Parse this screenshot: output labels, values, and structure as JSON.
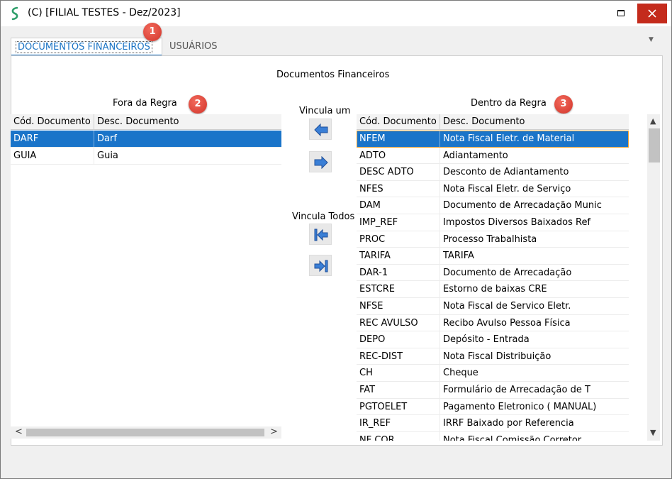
{
  "window": {
    "title": "(C)  [FILIAL TESTES - Dez/2023]",
    "icon": "s-logo-icon",
    "accent": "#1a74c9"
  },
  "tabs": [
    {
      "label": "DOCUMENTOS FINANCEIROS",
      "active": true
    },
    {
      "label": "USUÁRIOS",
      "active": false
    }
  ],
  "badges": [
    "1",
    "2",
    "3"
  ],
  "section_title": "Documentos Financeiros",
  "left_grid": {
    "title": "Fora da Regra",
    "headers": [
      "Cód. Documento",
      "Desc. Documento"
    ],
    "rows": [
      {
        "cod": "DARF",
        "desc": "Darf",
        "selected": true
      },
      {
        "cod": "GUIA",
        "desc": "Guia",
        "selected": false
      }
    ]
  },
  "middle": {
    "vincula_um": "Vincula um",
    "vincula_todos": "Vincula Todos"
  },
  "right_grid": {
    "title": "Dentro da Regra",
    "headers": [
      "Cód. Documento",
      "Desc. Documento"
    ],
    "rows": [
      {
        "cod": "NFEM",
        "desc": "Nota Fiscal Eletr. de Material",
        "selected": true
      },
      {
        "cod": "ADTO",
        "desc": "Adiantamento"
      },
      {
        "cod": "DESC ADTO",
        "desc": "Desconto de Adiantamento"
      },
      {
        "cod": "NFES",
        "desc": "Nota Fiscal Eletr. de Serviço"
      },
      {
        "cod": "DAM",
        "desc": "Documento de Arrecadação Munic"
      },
      {
        "cod": "IMP_REF",
        "desc": "Impostos Diversos Baixados Ref"
      },
      {
        "cod": "PROC",
        "desc": "Processo Trabalhista"
      },
      {
        "cod": "TARIFA",
        "desc": "TARIFA"
      },
      {
        "cod": "DAR-1",
        "desc": "Documento de Arrecadação"
      },
      {
        "cod": "ESTCRE",
        "desc": "Estorno de baixas CRE"
      },
      {
        "cod": "NFSE",
        "desc": "Nota Fiscal de Servico Eletr."
      },
      {
        "cod": "REC AVULSO",
        "desc": "Recibo Avulso Pessoa Física"
      },
      {
        "cod": "DEPO",
        "desc": "Depósito - Entrada"
      },
      {
        "cod": "REC-DIST",
        "desc": "Nota Fiscal Distribuição"
      },
      {
        "cod": "CH",
        "desc": "Cheque"
      },
      {
        "cod": "FAT",
        "desc": "Formulário de Arrecadação de T"
      },
      {
        "cod": "PGTOELET",
        "desc": "Pagamento Eletronico ( MANUAL)"
      },
      {
        "cod": "IR_REF",
        "desc": "IRRF Baixado por Referencia"
      },
      {
        "cod": "NF COR",
        "desc": "Nota Fiscal Comissão Corretor"
      }
    ]
  }
}
